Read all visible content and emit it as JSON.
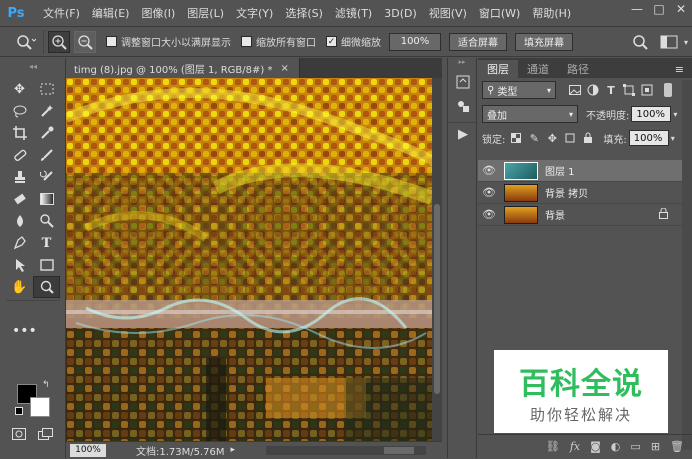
{
  "app": {
    "logo": "Ps"
  },
  "menu": [
    "文件(F)",
    "编辑(E)",
    "图像(I)",
    "图层(L)",
    "文字(Y)",
    "选择(S)",
    "滤镜(T)",
    "3D(D)",
    "视图(V)",
    "窗口(W)",
    "帮助(H)"
  ],
  "window_controls": {
    "minimize": "—",
    "maximize": "□",
    "close": "✕"
  },
  "options": {
    "resize_windows_label": "调整窗口大小以满屏显示",
    "resize_windows_checked": false,
    "zoom_all_label": "缩放所有窗口",
    "zoom_all_checked": false,
    "scrubby_zoom_label": "细微缩放",
    "scrubby_zoom_checked": true,
    "btn_100": "100%",
    "btn_fit": "适合屏幕",
    "btn_fill": "填充屏幕"
  },
  "document": {
    "tab_title": "timg (8).jpg @ 100% (图层 1, RGB/8#) *",
    "close": "×",
    "zoom": "100%",
    "doc_info": "文档:1.73M/5.76M"
  },
  "layers_panel": {
    "tabs": [
      "图层",
      "通道",
      "路径"
    ],
    "filter_kind": "类型",
    "blend_mode": "叠加",
    "opacity_label": "不透明度:",
    "opacity_value": "100%",
    "lock_label": "锁定:",
    "fill_label": "填充:",
    "fill_value": "100%",
    "layers": [
      {
        "name": "图层 1",
        "selected": true,
        "locked": false
      },
      {
        "name": "背景 拷贝",
        "selected": false,
        "locked": false
      },
      {
        "name": "背景",
        "selected": false,
        "locked": true
      }
    ]
  },
  "watermark": {
    "title": "百科全说",
    "subtitle": "助你轻松解决"
  },
  "colors": {
    "foreground": "#000000",
    "background": "#ffffff",
    "accent": "#3fa9f5",
    "watermark": "#2fbd5e"
  }
}
